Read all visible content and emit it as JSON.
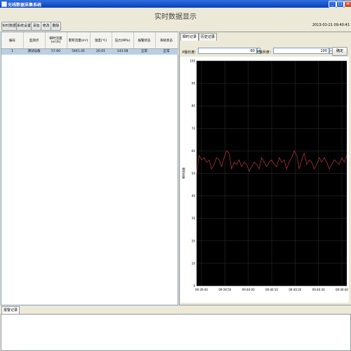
{
  "window": {
    "title": "无线数据采集系统",
    "minimize": "_",
    "maximize": "□",
    "close": "×"
  },
  "header": {
    "page_title": "实时数据显示"
  },
  "toolbar": {
    "buttons": [
      "实时数据",
      "系统设置",
      "添加",
      "修改",
      "删除"
    ],
    "datetime": "2013-03-21 09:40:41"
  },
  "table": {
    "columns": [
      "编号",
      "监测点",
      "瞬时流量(m³/h)",
      "累积流量(m³)",
      "温度(℃)",
      "压力(MPa)",
      "报警状态",
      "系统状态"
    ],
    "rows": [
      [
        "1",
        "测试设备",
        "57.60",
        "5441.45",
        "20.01",
        "143.58",
        "正常",
        "正常"
      ]
    ]
  },
  "tabs": [
    "瞬时记录",
    "历史记录"
  ],
  "controls": {
    "x_label": "X轴长度：",
    "x_value": "60",
    "y_label": "Y轴长度：",
    "y_value": "100",
    "ok_label": "确定",
    "spin_symbol": "—"
  },
  "chart_data": {
    "type": "line",
    "ylabel": "瞬时流量",
    "ylim": [
      0,
      100
    ],
    "yticks": [
      0,
      10,
      20,
      30,
      40,
      50,
      60,
      70,
      80,
      90,
      100
    ],
    "xticks": [
      "09:39:40",
      "09:39:50",
      "09:40:00",
      "09:40:10",
      "09:40:20",
      "09:40:30",
      "09:40:40"
    ],
    "line_color": "#c03838",
    "background": "#000000",
    "grid": true,
    "series": [
      {
        "values": [
          50,
          58,
          56,
          57,
          55,
          56,
          52,
          54,
          57,
          56,
          53,
          57,
          60,
          59,
          52,
          55,
          54,
          56,
          53,
          55,
          54,
          51,
          53,
          55,
          54,
          52,
          57,
          55,
          53,
          55,
          56,
          54,
          53,
          57,
          55,
          56,
          52,
          55,
          57,
          60,
          58,
          52,
          56,
          59,
          54,
          56,
          55,
          52,
          54,
          57,
          55,
          57,
          55,
          52,
          54,
          56,
          55,
          54,
          57,
          55,
          58
        ]
      }
    ]
  },
  "bottom": {
    "tab": "报警记录"
  }
}
